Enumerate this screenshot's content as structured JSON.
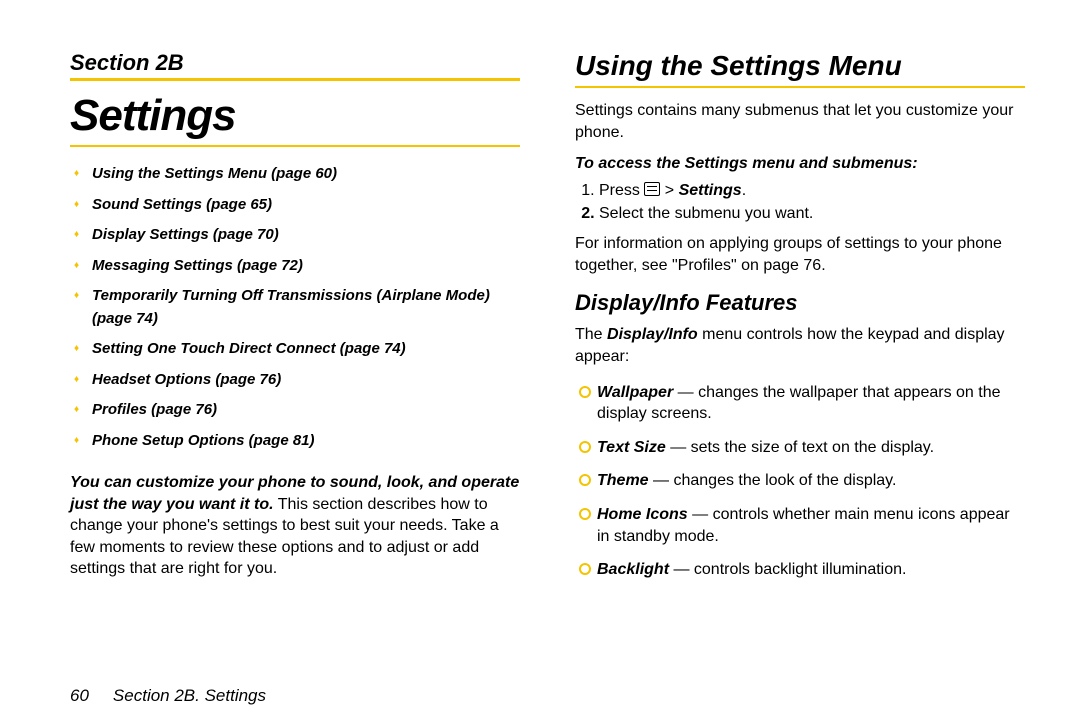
{
  "left": {
    "section_label": "Section 2B",
    "title": "Settings",
    "toc": [
      "Using the Settings Menu (page 60)",
      "Sound Settings (page 65)",
      "Display Settings (page 70)",
      "Messaging Settings (page 72)",
      "Temporarily Turning Off Transmissions (Airplane Mode) (page 74)",
      "Setting One Touch Direct Connect (page 74)",
      "Headset Options (page 76)",
      "Profiles (page 76)",
      "Phone Setup Options (page 81)"
    ],
    "intro_bolditalic": "You can customize your phone to sound, look, and operate just the way you want it to.",
    "intro_rest": " This section describes how to change your phone's settings to best suit your needs. Take a few moments to review these options and to adjust or add settings that are right for you."
  },
  "right": {
    "h1": "Using the Settings Menu",
    "intro": "Settings contains many submenus that let you customize your phone.",
    "instr": "To access the Settings menu and submenus:",
    "step1_prefix": "Press ",
    "step1_gt": " > ",
    "step1_suffix": "Settings",
    "step1_period": ".",
    "step2": "Select the submenu you want.",
    "para2": "For information on applying groups of settings to your phone together, see \"Profiles\" on page 76.",
    "h2": "Display/Info Features",
    "para3_prefix": "The ",
    "para3_term": "Display/Info",
    "para3_rest": " menu controls how the keypad and display appear:",
    "features": [
      {
        "name": "Wallpaper",
        "desc": " — changes the wallpaper that appears on the display screens."
      },
      {
        "name": "Text Size",
        "desc": " — sets the size of text on the display."
      },
      {
        "name": "Theme",
        "desc": " — changes the look of the display."
      },
      {
        "name": "Home Icons",
        "desc": " — controls whether main menu icons appear in standby mode."
      },
      {
        "name": "Backlight",
        "desc": " — controls backlight illumination."
      }
    ]
  },
  "footer": {
    "page_number": "60",
    "text": "Section 2B. Settings"
  }
}
